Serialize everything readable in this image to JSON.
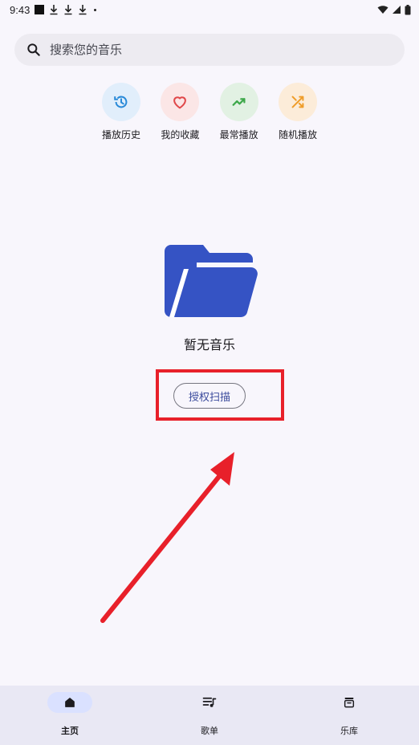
{
  "status_bar": {
    "time": "9:43"
  },
  "search": {
    "placeholder": "搜索您的音乐"
  },
  "quick_actions": [
    {
      "label": "播放历史",
      "icon": "history-icon",
      "bg": "#e1eefb",
      "color": "#2a8ad8"
    },
    {
      "label": "我的收藏",
      "icon": "heart-icon",
      "bg": "#fbe6e6",
      "color": "#e0484a"
    },
    {
      "label": "最常播放",
      "icon": "trending-up-icon",
      "bg": "#e2f1e3",
      "color": "#3da84a"
    },
    {
      "label": "随机播放",
      "icon": "shuffle-icon",
      "bg": "#fcecd9",
      "color": "#ef9d2a"
    }
  ],
  "empty_state": {
    "icon": "folder-open-icon",
    "message": "暂无音乐",
    "button_label": "授权扫描",
    "accent": "#3553c4"
  },
  "annotation": {
    "color": "#e8202a"
  },
  "bottom_nav": [
    {
      "label": "主页",
      "icon": "home-icon",
      "active": true
    },
    {
      "label": "歌单",
      "icon": "playlist-icon",
      "active": false
    },
    {
      "label": "乐库",
      "icon": "library-icon",
      "active": false
    }
  ]
}
